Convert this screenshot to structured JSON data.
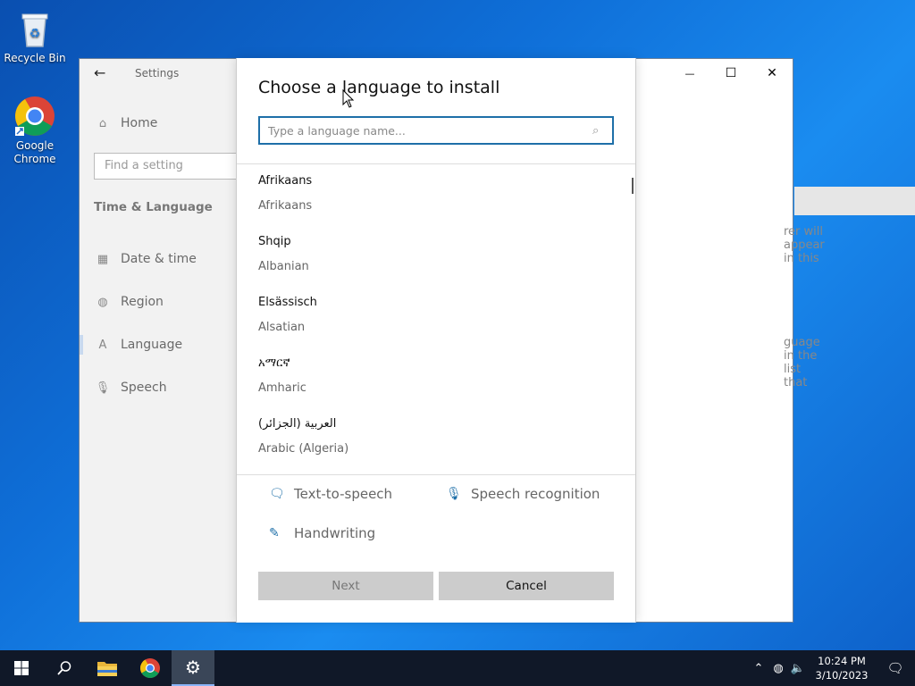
{
  "desktop": {
    "icons": [
      {
        "label": "Recycle Bin"
      },
      {
        "label": "Google Chrome"
      }
    ]
  },
  "window": {
    "title": "Settings",
    "controls": {
      "minimize": "—",
      "maximize": "☐",
      "close": "✕"
    }
  },
  "sidebar": {
    "home": "Home",
    "search_placeholder": "Find a setting",
    "section": "Time & Language",
    "items": [
      {
        "label": "Date & time",
        "icon": "calendar-icon"
      },
      {
        "label": "Region",
        "icon": "globe-icon"
      },
      {
        "label": "Language",
        "icon": "language-icon"
      },
      {
        "label": "Speech",
        "icon": "microphone-icon"
      }
    ]
  },
  "background_text": {
    "line1": "rer will appear in this",
    "line2": "guage in the list that"
  },
  "dialog": {
    "title": "Choose a language to install",
    "search_placeholder": "Type a language name...",
    "languages": [
      {
        "native": "Afrikaans",
        "english": "Afrikaans"
      },
      {
        "native": "Shqip",
        "english": "Albanian"
      },
      {
        "native": "Elsässisch",
        "english": "Alsatian"
      },
      {
        "native": "አማርኛ",
        "english": "Amharic"
      },
      {
        "native": "العربية (الجزائر)",
        "english": "Arabic (Algeria)"
      }
    ],
    "features": {
      "tts": "Text-to-speech",
      "speech": "Speech recognition",
      "handwriting": "Handwriting"
    },
    "buttons": {
      "next": "Next",
      "cancel": "Cancel"
    }
  },
  "taskbar": {
    "clock_time": "10:24 PM",
    "clock_date": "3/10/2023"
  },
  "colors": {
    "accent": "#1e6fa8",
    "taskbar": "#101828",
    "desktop": "#0f6fd8"
  }
}
